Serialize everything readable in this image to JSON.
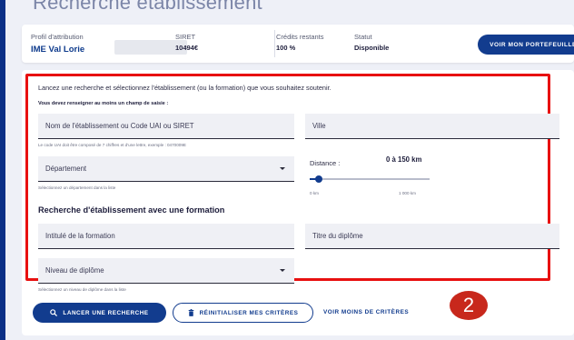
{
  "page": {
    "title": "Recherche établissement"
  },
  "info": {
    "profile_label": "Profil d'attribution",
    "profile_value": "IME Val Lorie",
    "siret_label": "SIRET",
    "siret_value": "10494€",
    "credits_label": "Crédits restants",
    "credits_value": "100 %",
    "status_label": "Statut",
    "status_value": "Disponible",
    "portfolio_button": "VOIR MON PORTEFEUILLE"
  },
  "search": {
    "intro": "Lancez une recherche et sélectionnez l'établissement (ou la formation) que vous souhaitez soutenir.",
    "required_note": "Vous devez renseigner au moins un champ de saisie :",
    "name_placeholder": "Nom de l'établissement ou Code UAI ou SIRET",
    "name_hint": "Le code UAI doit être composé de 7 chiffres et d'une lettre, exemple : 0470009E",
    "city_placeholder": "Ville",
    "department_label": "Département",
    "department_hint": "Sélectionnez un département dans la liste",
    "distance_label": "Distance :",
    "distance_value": "0 à 150 km",
    "distance_min": "0 km",
    "distance_max": "1 000 km",
    "distance_level_km": 150
  },
  "formation": {
    "section_title": "Recherche d'établissement avec une formation",
    "training_placeholder": "Intitulé de la formation",
    "diploma_title_placeholder": "Titre du diplôme",
    "diploma_level_label": "Niveau de diplôme",
    "diploma_level_hint": "Sélectionnez un niveau de diplôme dans la liste"
  },
  "actions": {
    "search_button": "LANCER UNE RECHERCHE",
    "reset_button": "RÉINITIALISER MES CRITÈRES",
    "less_criteria_link": "VOIR MOINS DE CRITÈRES"
  },
  "annotation": {
    "step_number": "2"
  },
  "colors": {
    "primary": "#123c8e",
    "highlight_border": "#e81010",
    "badge": "#c8281c",
    "frame": "#0b2f86"
  }
}
